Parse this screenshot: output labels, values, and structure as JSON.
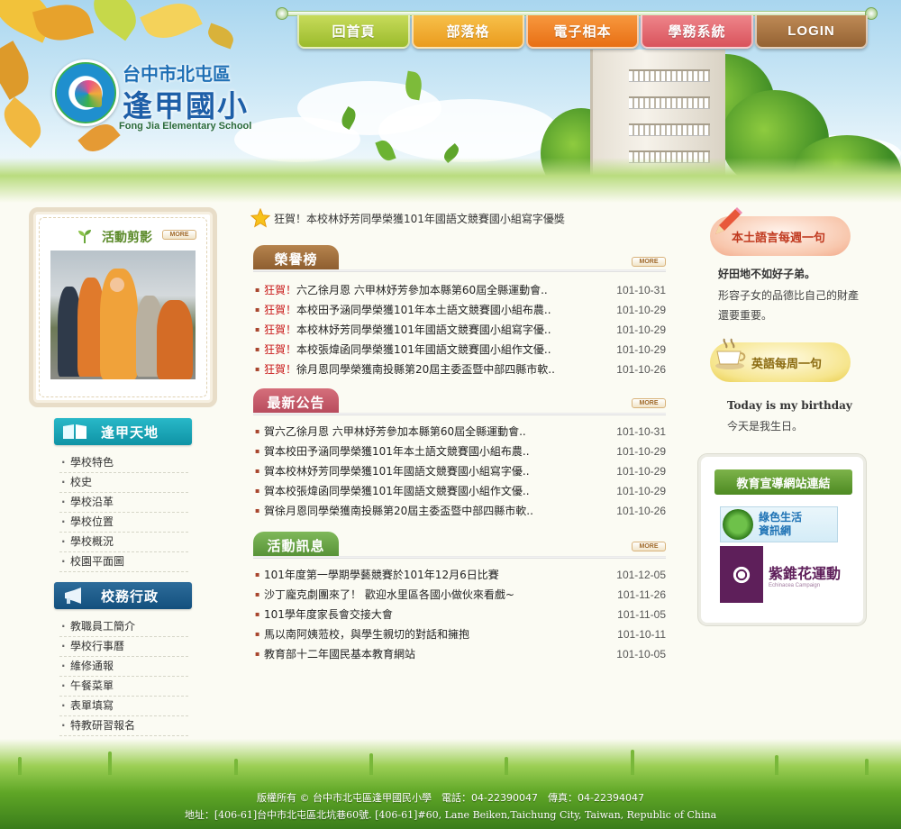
{
  "header": {
    "school_city": "台中市北屯區",
    "school_name": "逢甲國小",
    "school_name_en": "Fong Jia Elementary School"
  },
  "nav": [
    {
      "label": "回首頁",
      "color": "#a7c437"
    },
    {
      "label": "部落格",
      "color": "#f0a72b"
    },
    {
      "label": "電子相本",
      "color": "#ef7a1f"
    },
    {
      "label": "學務系統",
      "color": "#e1626a"
    },
    {
      "label": "LOGIN",
      "color": "#a5703f"
    }
  ],
  "sidebar": {
    "photo_title": "活動剪影",
    "more": "MORE",
    "campus_title": "逢甲天地",
    "campus_items": [
      "學校特色",
      "校史",
      "學校沿革",
      "學校位置",
      "學校概況",
      "校園平面圖"
    ],
    "admin_title": "校務行政",
    "admin_items": [
      "教職員工簡介",
      "學校行事曆",
      "維修通報",
      "午餐菜單",
      "表單填寫",
      "特教研習報名"
    ]
  },
  "main": {
    "headline": "狂賀！本校林妤芳同學榮獲101年國語文競賽國小組寫字優獎",
    "honor": {
      "title": "榮譽榜",
      "items": [
        {
          "hi": "狂賀！",
          "text": "六乙徐月恩 六甲林妤芳參加本縣第60屆全縣運動會..",
          "date": "101-10-31"
        },
        {
          "hi": "狂賀！",
          "text": "本校田予涵同學榮獲101年本土語文競賽國小組布農..",
          "date": "101-10-29"
        },
        {
          "hi": "狂賀！",
          "text": "本校林妤芳同學榮獲101年國語文競賽國小組寫字優..",
          "date": "101-10-29"
        },
        {
          "hi": "狂賀！",
          "text": "本校張煒函同學榮獲101年國語文競賽國小組作文優..",
          "date": "101-10-29"
        },
        {
          "hi": "狂賀！",
          "text": "徐月恩同學榮獲南投縣第20屆主委盃暨中部四縣市軟..",
          "date": "101-10-26"
        }
      ]
    },
    "news": {
      "title": "最新公告",
      "items": [
        {
          "text": "賀六乙徐月恩 六甲林妤芳參加本縣第60屆全縣運動會..",
          "date": "101-10-31"
        },
        {
          "text": "賀本校田予涵同學榮獲101年本土語文競賽國小組布農..",
          "date": "101-10-29"
        },
        {
          "text": "賀本校林妤芳同學榮獲101年國語文競賽國小組寫字優..",
          "date": "101-10-29"
        },
        {
          "text": "賀本校張煒函同學榮獲101年國語文競賽國小組作文優..",
          "date": "101-10-29"
        },
        {
          "text": "賀徐月恩同學榮獲南投縣第20屆主委盃暨中部四縣市軟..",
          "date": "101-10-26"
        }
      ]
    },
    "events": {
      "title": "活動訊息",
      "items": [
        {
          "text": "101年度第一學期學藝競賽於101年12月6日比賽",
          "date": "101-12-05"
        },
        {
          "text": "沙丁龐克劇團來了！ 歡迎水里區各國小做伙來看戲~",
          "date": "101-11-26"
        },
        {
          "text": "101學年度家長會交接大會",
          "date": "101-11-05"
        },
        {
          "text": "馬以南阿姨蒞校，與學生親切的對話和擁抱",
          "date": "101-10-11"
        },
        {
          "text": "教育部十二年國民基本教育網站",
          "date": "101-10-05"
        }
      ]
    }
  },
  "right": {
    "local_title": "本土語言每週一句",
    "local_phrase": "好田地不如好子弟。",
    "local_desc": "形容子女的品德比自己的財產還要重要。",
    "english_title": "英語每周一句",
    "english_phrase": "Today is my birthday",
    "english_desc": "今天是我生日。",
    "links_title": "教育宣導網站連結",
    "green_life": "綠色生活\n資訊網",
    "green_life_l1": "綠色生活",
    "green_life_l2": "資訊網",
    "zhu_hua": "紫錐花運動",
    "zhu_hua_en": "Echinacea Campaign"
  },
  "footer": {
    "copyright": "版權所有 © 台中市北屯區逢甲國民小學　電話：04-22390047　傳真：04-22394047",
    "address": "地址：[406-61]台中市北屯區北坑巷60號. [406-61]#60, Lane Beiken,Taichung City, Taiwan, Republic of China"
  }
}
